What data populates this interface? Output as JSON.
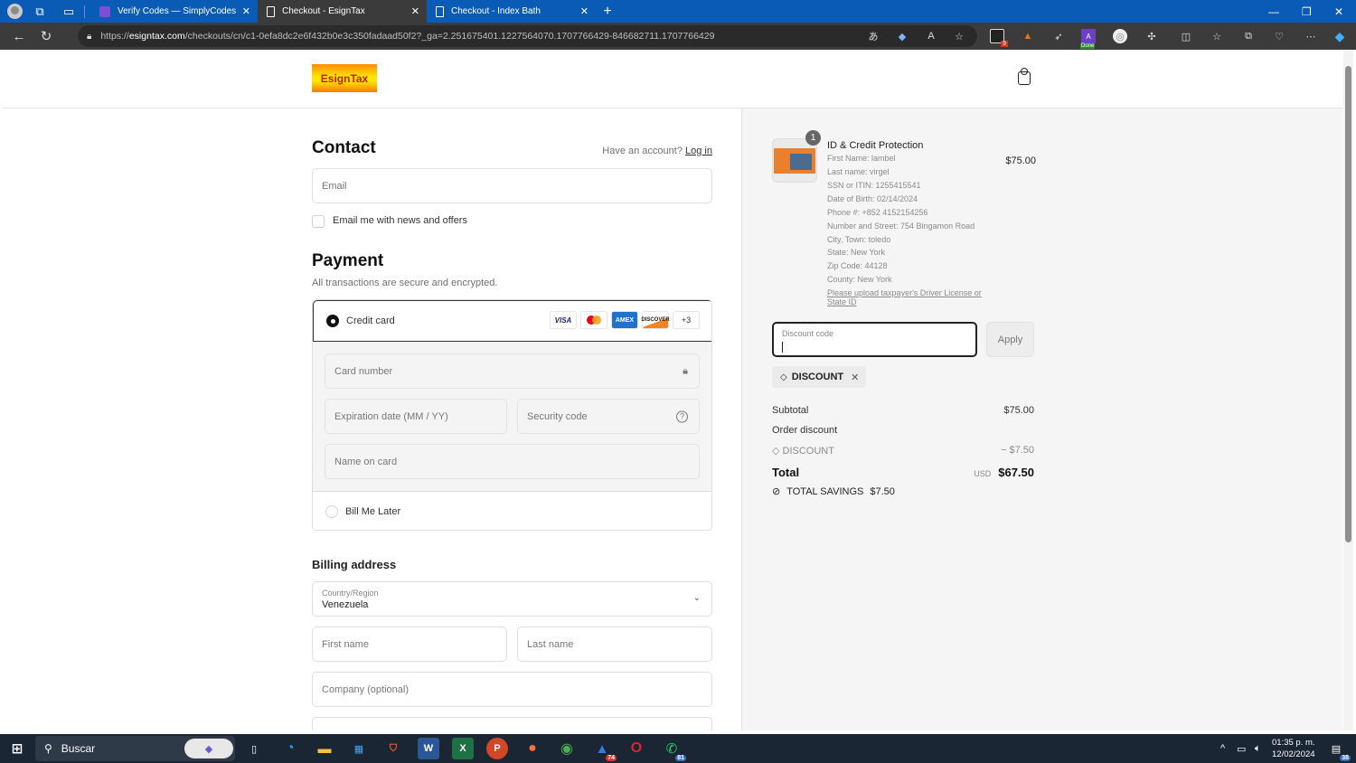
{
  "browser": {
    "tabs": [
      {
        "title": "Verify Codes — SimplyCodes",
        "active": false,
        "favicon": "simplycodes-icon"
      },
      {
        "title": "Checkout - EsignTax",
        "active": true,
        "favicon": "page-icon"
      },
      {
        "title": "Checkout - Index Bath",
        "active": false,
        "favicon": "page-icon"
      }
    ],
    "url_domain": "esigntax.com",
    "url_prefix": "https://",
    "url_path": "/checkouts/cn/c1-0efa8dc2e6f432b0e3c350fadaad50f2?_ga=2.251675401.1227564070.1707766429-846682711.1707766429",
    "extension_badges": {
      "ext1": "9",
      "ext4": "Done"
    }
  },
  "store": {
    "logo_text": "EsignTax"
  },
  "contact": {
    "heading": "Contact",
    "account_prompt": "Have an account?",
    "login_link": "Log in",
    "email_placeholder": "Email",
    "newsletter_label": "Email me with news and offers",
    "newsletter_checked": false
  },
  "payment": {
    "heading": "Payment",
    "subtitle": "All transactions are secure and encrypted.",
    "methods": [
      {
        "label": "Credit card",
        "selected": true
      },
      {
        "label": "Bill Me Later",
        "selected": false
      }
    ],
    "card_brands": [
      "VISA",
      "Mastercard",
      "AMEX",
      "DISCOVER"
    ],
    "more_brands": "+3",
    "card_number_placeholder": "Card number",
    "expiration_placeholder": "Expiration date (MM / YY)",
    "security_code_placeholder": "Security code",
    "name_on_card_placeholder": "Name on card"
  },
  "billing": {
    "heading": "Billing address",
    "country_label": "Country/Region",
    "country_value": "Venezuela",
    "first_name_placeholder": "First name",
    "last_name_placeholder": "Last name",
    "company_placeholder": "Company (optional)"
  },
  "summary": {
    "item": {
      "quantity": "1",
      "title": "ID & Credit Protection",
      "price": "$75.00",
      "details": [
        "First Name: lambel",
        "Last name: virgel",
        "SSN or ITIN: 1255415541",
        "Date of Birth: 02/14/2024",
        "Phone #: +852 4152154256",
        "Number and Street: 754 Bingamon Road",
        "City, Town: toledo",
        "State: New York",
        "Zip Code: 44128",
        "County: New York"
      ],
      "link": "Please upload taxpayer's Driver License or State ID"
    },
    "discount_label": "Discount code",
    "apply_label": "Apply",
    "applied_code": "DISCOUNT",
    "subtotal_label": "Subtotal",
    "subtotal_value": "$75.00",
    "order_discount_label": "Order discount",
    "discount_code_label": "DISCOUNT",
    "discount_value": "− $7.50",
    "total_label": "Total",
    "currency": "USD",
    "total_value": "$67.50",
    "savings_label": "TOTAL SAVINGS",
    "savings_value": "$7.50"
  },
  "taskbar": {
    "search_label": "Buscar",
    "badges": {
      "app12": "74",
      "whatsapp": "81",
      "notifications": "38"
    },
    "time": "01:35 p. m.",
    "date": "12/02/2024"
  }
}
